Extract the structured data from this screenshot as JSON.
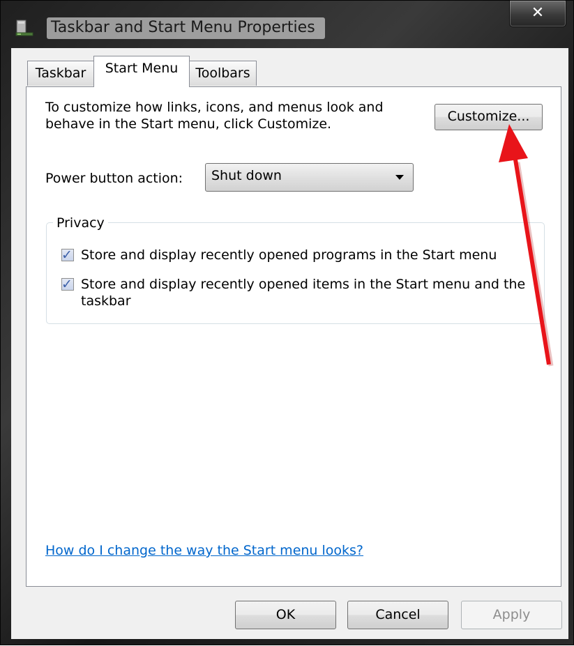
{
  "window": {
    "title": "Taskbar and Start Menu Properties",
    "close_glyph": "✕",
    "icon": "taskbar-properties-icon"
  },
  "tabs": [
    {
      "label": "Taskbar",
      "active": false
    },
    {
      "label": "Start Menu",
      "active": true
    },
    {
      "label": "Toolbars",
      "active": false
    }
  ],
  "start_menu": {
    "description_line1": "To customize how links, icons, and menus look and",
    "description_line2": "behave in the Start menu, click Customize.",
    "customize_label": "Customize...",
    "power_label": "Power button action:",
    "power_value": "Shut down",
    "privacy": {
      "label": "Privacy",
      "item1": "Store and display recently opened programs in the Start menu",
      "item1_checked": true,
      "item2_line1": "Store and display recently opened items in the Start menu and the",
      "item2_line2": "taskbar",
      "item2_checked": true
    },
    "help_link": "How do I change the way the Start menu looks?"
  },
  "footer": {
    "ok_label": "OK",
    "cancel_label": "Cancel",
    "apply_label": "Apply",
    "apply_enabled": false
  },
  "annotation": {
    "shape": "red-arrow",
    "color": "#e8141a",
    "points_to": "Customize..."
  },
  "colors": {
    "title_frame": "#2b2b2b",
    "link": "#0066cc",
    "checkbox_mark": "#3b5fa8"
  }
}
